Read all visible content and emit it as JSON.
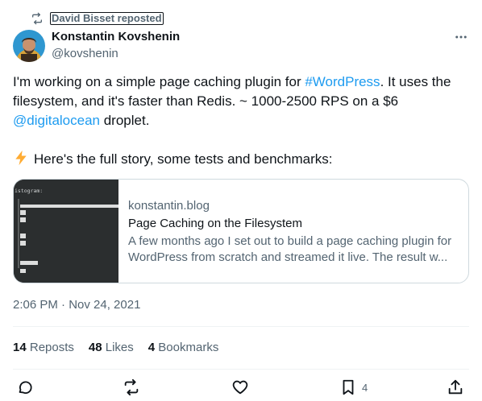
{
  "repost": {
    "label": "David Bisset reposted"
  },
  "author": {
    "display_name": "Konstantin Kovshenin",
    "handle": "@kovshenin"
  },
  "tweet": {
    "line1_pre": "I'm working on a simple page caching plugin for ",
    "line1_link": "#WordPress",
    "line1_post": ". It uses the",
    "line2": "filesystem, and it's faster than Redis. ~ 1000-2500 RPS on a $6",
    "line3_link": "@digitalocean",
    "line3_post": " droplet.",
    "line4": "Here's the full story, some tests and benchmarks:"
  },
  "card": {
    "domain": "konstantin.blog",
    "title": "Page Caching on the Filesystem",
    "desc_line1": "A few months ago I set out to build a page caching plugin for",
    "desc_line2": "WordPress from scratch and streamed it live. The result w...",
    "thumb_text": "istogram:"
  },
  "meta": {
    "timestamp": "2:06 PM · Nov 24, 2021"
  },
  "stats": {
    "reposts_count": "14",
    "reposts_label": "Reposts",
    "likes_count": "48",
    "likes_label": "Likes",
    "bookmarks_count": "4",
    "bookmarks_label": "Bookmarks"
  },
  "actions": {
    "bookmark_count": "4"
  },
  "colors": {
    "accent": "#1d9bf0",
    "secondary_text": "#536471",
    "primary_text": "#0f1419",
    "border": "#cfd9de"
  },
  "icons": [
    "repost-icon",
    "more-icon",
    "reply-icon",
    "retweet-icon",
    "like-icon",
    "bookmark-icon",
    "share-icon",
    "lightning-emoji"
  ]
}
